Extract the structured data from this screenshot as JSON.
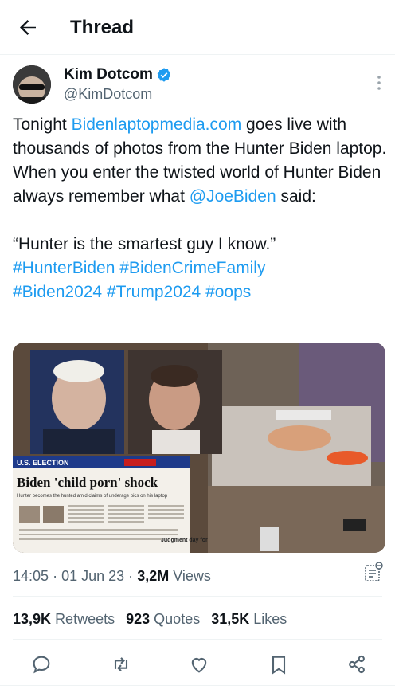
{
  "header": {
    "title": "Thread"
  },
  "tweet": {
    "author_name": "Kim Dotcom",
    "author_handle": "@KimDotcom",
    "verified": true,
    "text_parts": {
      "p1": "Tonight ",
      "link1": "Bidenlaptopmedia.com",
      "p2": " goes live with thousands of photos from the Hunter Biden laptop. When you enter the twisted world of Hunter Biden always remember what ",
      "mention": "@JoeBiden",
      "p3": " said:\n\n“Hunter is the smartest guy I know.”\n",
      "hashtags1": "#HunterBiden #BidenCrimeFamily",
      "newline": "\n",
      "hashtags2": "#Biden2024 #Trump2024 #oops"
    },
    "media": {
      "headline": "Biden 'child porn' shock",
      "section": "U.S. ELECTION",
      "subhead": "Hunter becomes the hunted amid claims of underage pics on his laptop",
      "stamp": "Judgment day for"
    },
    "time": "14:05",
    "date": "01 Jun 23",
    "views_count": "3,2M",
    "views_label": "Views",
    "retweets_count": "13,9K",
    "retweets_label": "Retweets",
    "quotes_count": "923",
    "quotes_label": "Quotes",
    "likes_count": "31,5K",
    "likes_label": "Likes"
  },
  "colors": {
    "accent": "#1d9bf0",
    "text": "#0f1419",
    "muted": "#536471",
    "divider": "#eff3f4"
  },
  "icons": [
    "back-arrow-icon",
    "verified-badge-icon",
    "more-icon",
    "analytics-icon",
    "reply-icon",
    "retweet-icon",
    "like-icon",
    "bookmark-icon",
    "share-icon"
  ]
}
